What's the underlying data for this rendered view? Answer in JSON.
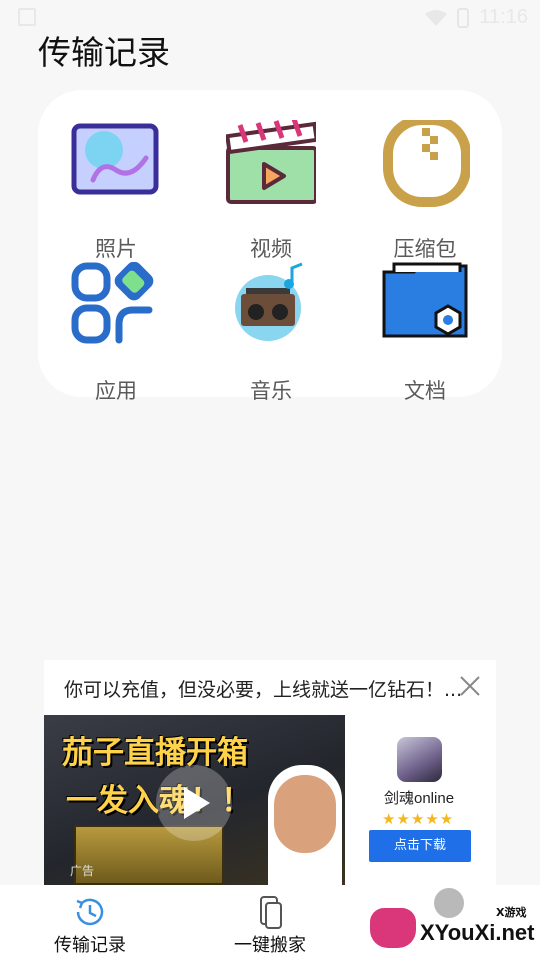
{
  "statusbar": {
    "time": "11:16"
  },
  "header": {
    "title": "传输记录"
  },
  "categories": [
    {
      "label": "照片",
      "icon": "photo-icon"
    },
    {
      "label": "视频",
      "icon": "video-icon"
    },
    {
      "label": "压缩包",
      "icon": "archive-icon"
    },
    {
      "label": "应用",
      "icon": "app-icon"
    },
    {
      "label": "音乐",
      "icon": "music-icon"
    },
    {
      "label": "文档",
      "icon": "document-icon"
    }
  ],
  "ad": {
    "title": "你可以充值，但没必要，上线就送一亿钻石！...",
    "headline_line1": "茄子直播开箱",
    "headline_line2": "一发入魂！！",
    "tag": "广告",
    "app_name": "剑魂online",
    "stars": "★★★★★",
    "download_label": "点击下载"
  },
  "tabbar": {
    "items": [
      {
        "label": "传输记录",
        "icon": "clock-icon",
        "active": true
      },
      {
        "label": "一键搬家",
        "icon": "phones-icon",
        "active": false
      }
    ]
  },
  "watermark": {
    "small": "X游戏",
    "text": "XYouXi.net"
  },
  "colors": {
    "accent": "#1f6fe8",
    "tab_active_icon": "#3a8fe0",
    "title_text": "#111111",
    "label_text": "#5a5a5a"
  }
}
